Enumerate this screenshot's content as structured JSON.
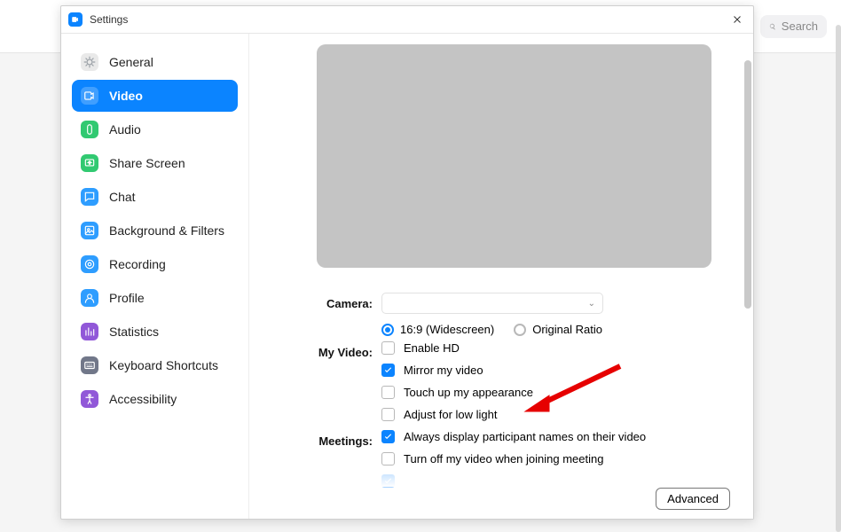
{
  "shell": {
    "search_placeholder": "Search"
  },
  "window": {
    "title": "Settings",
    "advanced_label": "Advanced"
  },
  "sidebar": {
    "items": [
      {
        "key": "general",
        "label": "General",
        "icon_bg": "#e9e9e9",
        "icon_fg": "#9aa0a6",
        "active": false
      },
      {
        "key": "video",
        "label": "Video",
        "icon_bg": "#ffffff",
        "icon_fg": "#ffffff",
        "active": true
      },
      {
        "key": "audio",
        "label": "Audio",
        "icon_bg": "#31c971",
        "icon_fg": "#ffffff",
        "active": false
      },
      {
        "key": "share-screen",
        "label": "Share Screen",
        "icon_bg": "#31c971",
        "icon_fg": "#ffffff",
        "active": false
      },
      {
        "key": "chat",
        "label": "Chat",
        "icon_bg": "#2e9dff",
        "icon_fg": "#ffffff",
        "active": false
      },
      {
        "key": "background-filters",
        "label": "Background & Filters",
        "icon_bg": "#2e9dff",
        "icon_fg": "#ffffff",
        "active": false
      },
      {
        "key": "recording",
        "label": "Recording",
        "icon_bg": "#2e9dff",
        "icon_fg": "#ffffff",
        "active": false
      },
      {
        "key": "profile",
        "label": "Profile",
        "icon_bg": "#2e9dff",
        "icon_fg": "#ffffff",
        "active": false
      },
      {
        "key": "statistics",
        "label": "Statistics",
        "icon_bg": "#9158d8",
        "icon_fg": "#ffffff",
        "active": false
      },
      {
        "key": "keyboard-shortcuts",
        "label": "Keyboard Shortcuts",
        "icon_bg": "#717789",
        "icon_fg": "#ffffff",
        "active": false
      },
      {
        "key": "accessibility",
        "label": "Accessibility",
        "icon_bg": "#9158d8",
        "icon_fg": "#ffffff",
        "active": false
      }
    ]
  },
  "video": {
    "camera_label": "Camera:",
    "camera_value": "",
    "ratio_169": "16:9 (Widescreen)",
    "ratio_original": "Original Ratio",
    "ratio_selected": "169",
    "myvideo_label": "My Video:",
    "enable_hd": {
      "label": "Enable HD",
      "checked": false
    },
    "mirror": {
      "label": "Mirror my video",
      "checked": true
    },
    "touchup": {
      "label": "Touch up my appearance",
      "checked": false
    },
    "lowlight": {
      "label": "Adjust for low light",
      "checked": false
    },
    "meetings_label": "Meetings:",
    "display_names": {
      "label": "Always display participant names on their video",
      "checked": true
    },
    "turnoff_join": {
      "label": "Turn off my video when joining meeting",
      "checked": false
    }
  },
  "annotation": {
    "points_to": "touch-up-my-appearance-checkbox"
  }
}
